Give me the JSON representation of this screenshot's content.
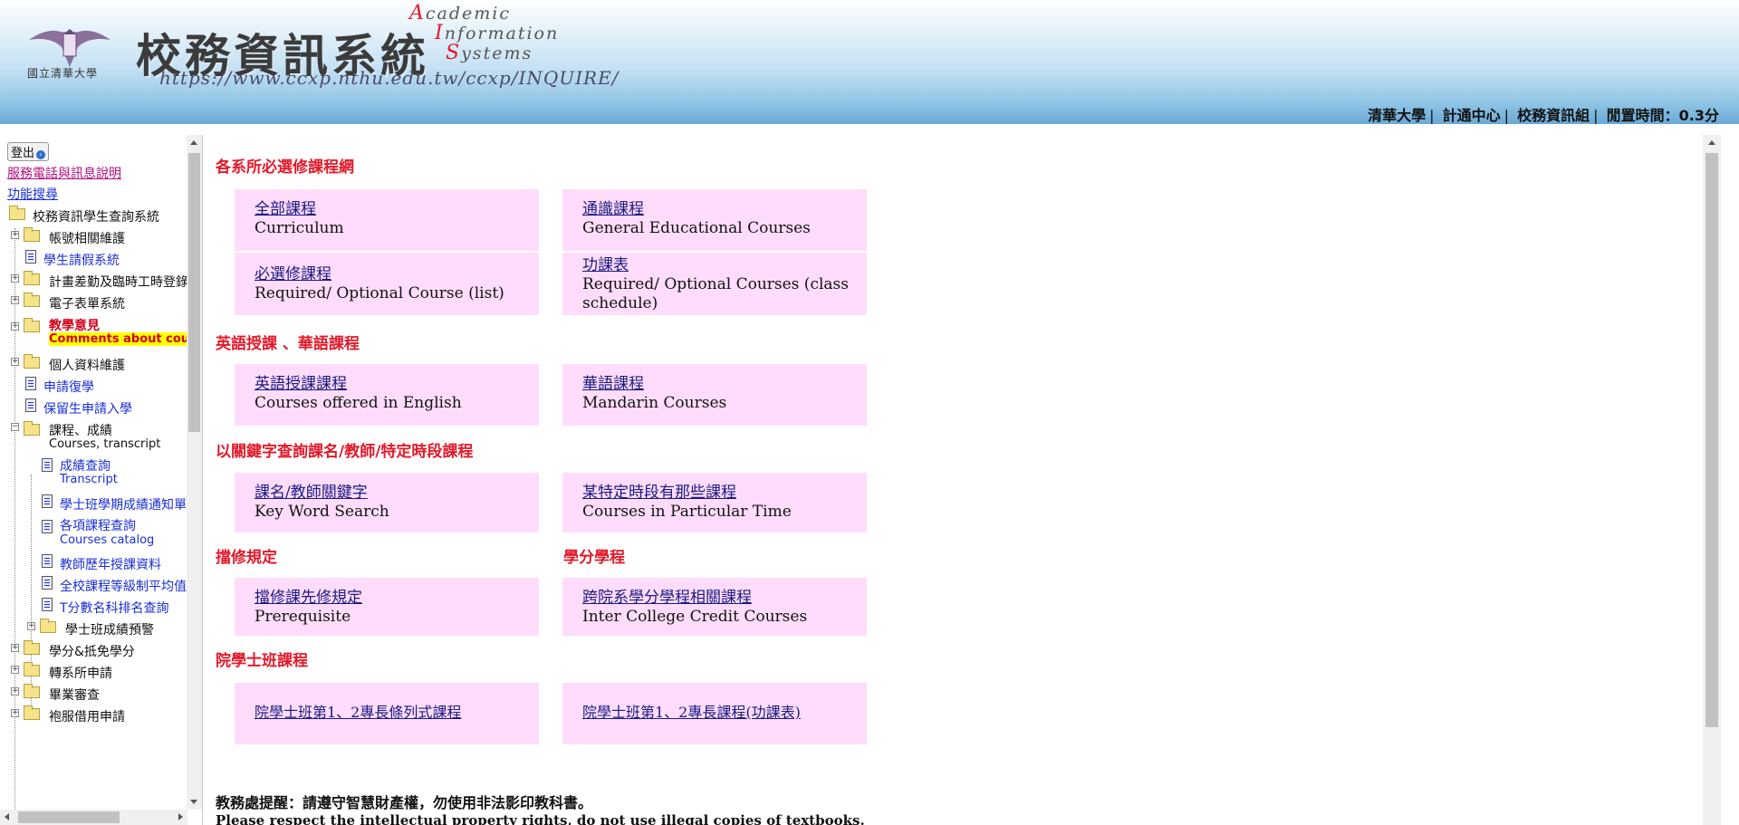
{
  "header": {
    "school_name": "國立清華大學",
    "system_title": "校務資訊系統",
    "en_title_lines": [
      {
        "cap": "A",
        "rest": "cademic"
      },
      {
        "cap": "I",
        "rest": "nformation"
      },
      {
        "cap": "S",
        "rest": "ystems"
      }
    ],
    "url": "https://www.ccxp.nthu.edu.tw/ccxp/INQUIRE/",
    "links": [
      "清華大學",
      "計通中心",
      "校務資訊組"
    ],
    "idle_label": "閒置時間：0.3分"
  },
  "sidebar": {
    "logout_label": "登出",
    "service_link": "服務電話與訊息說明",
    "search_link": "功能搜尋",
    "tree": {
      "root": "校務資訊學生查詢系統",
      "account": "帳號相關維護",
      "leave": "學生請假系統",
      "project": "計畫差勤及臨時工時登錄",
      "eform": "電子表單系統",
      "teaching": "教學意見",
      "teaching_en": "Comments about courses",
      "personal": "個人資料維護",
      "reinstate": "申請復學",
      "reserve": "保留生申請入學",
      "courses": "課程、成績",
      "courses_en": "Courses, transcript",
      "transcript": "成績查詢",
      "transcript_en": "Transcript",
      "bachelor_notice": "學士班學期成績通知單",
      "catalog": "各項課程查詢",
      "catalog_en": "Courses catalog",
      "teacher_history": "教師歷年授課資料",
      "grade_avg": "全校課程等級制平均值",
      "tscore": "T分數名科排名查詢",
      "warning": "學士班成績預警",
      "credit": "學分&抵免學分",
      "transfer": "轉系所申請",
      "graduation": "畢業審查",
      "gown": "袍服借用申請"
    }
  },
  "main": {
    "sections": {
      "required": "各系所必選修課程網",
      "english": "英語授課 、華語課程",
      "keyword": "以關鍵字查詢課名/教師/特定時段課程",
      "prereq": "擋修規定",
      "credit_program": "學分學程",
      "college": "院學士班課程"
    },
    "cards": {
      "curriculum_cn": "全部課程",
      "curriculum_en": "Curriculum",
      "ge_cn": "通識課程",
      "ge_en": "General Educational Courses",
      "req_list_cn": "必選修課程",
      "req_list_en": "Required/ Optional Course (list)",
      "req_sched_cn": "功課表",
      "req_sched_en": "Required/ Optional Courses (class schedule)",
      "eng_cn": "英語授課課程",
      "eng_en": "Courses offered in English",
      "mandarin_cn": "華語課程",
      "mandarin_en": "Mandarin Courses",
      "kw_cn": "課名/教師關鍵字",
      "kw_en": "Key Word Search",
      "time_cn": "某特定時段有那些課程",
      "time_en": "Courses in Particular Time",
      "prereq_cn": "擋修課先修規定",
      "prereq_en": "Prerequisite",
      "intercollege_cn": "跨院系學分學程相關課程",
      "intercollege_en": "Inter College Credit Courses",
      "college_list": "院學士班第1、2專長條列式課程",
      "college_sched": "院學士班第1、2專長課程(功課表)"
    },
    "notice_cn": "教務處提醒：請遵守智慧財產權，勿使用非法影印教科書。",
    "notice_en": "Please respect the intellectual property rights, do not use illegal copies of textbooks."
  }
}
